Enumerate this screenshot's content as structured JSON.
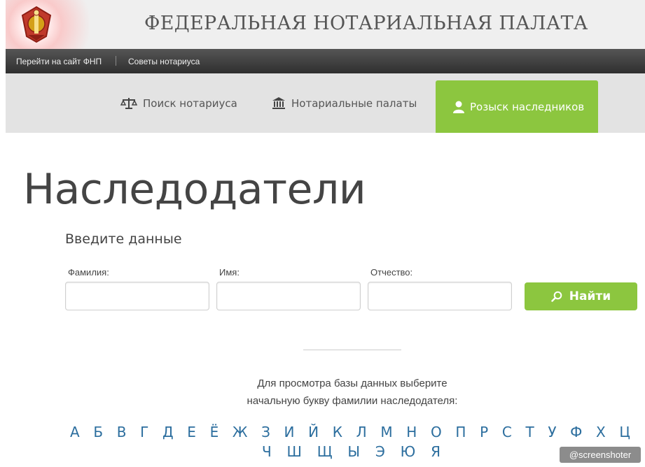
{
  "header": {
    "logo_icon": "fnp-emblem-icon",
    "title": "ФЕДЕРАЛЬНАЯ НОТАРИАЛЬНАЯ ПАЛАТА"
  },
  "topbar": {
    "links": [
      "Перейти на сайт ФНП",
      "Советы нотариуса"
    ]
  },
  "tabs": [
    {
      "label": "Поиск нотариуса",
      "icon": "scales-icon",
      "active": false
    },
    {
      "label": "Нотариальные палаты",
      "icon": "building-icon",
      "active": false
    },
    {
      "label": "Розыск наследников",
      "icon": "person-icon",
      "active": true
    }
  ],
  "page": {
    "title": "Наследодатели",
    "subtitle": "Введите данные"
  },
  "form": {
    "fields": [
      {
        "label": "Фамилия:",
        "value": ""
      },
      {
        "label": "Имя:",
        "value": ""
      },
      {
        "label": "Отчество:",
        "value": ""
      }
    ],
    "search_button": "Найти"
  },
  "hint": {
    "line1": "Для просмотра базы данных выберите",
    "line2": "начальную букву фамилии наследодателя:"
  },
  "alphabet": {
    "row1": [
      "А",
      "Б",
      "В",
      "Г",
      "Д",
      "Е",
      "Ё",
      "Ж",
      "З",
      "И",
      "Й",
      "К",
      "Л",
      "М",
      "Н",
      "О",
      "П",
      "Р",
      "С",
      "Т",
      "У",
      "Ф",
      "Х",
      "Ц"
    ],
    "row2": [
      "Ч",
      "Ш",
      "Щ",
      "Ы",
      "Э",
      "Ю",
      "Я"
    ]
  },
  "watermark": "@screenshoter",
  "colors": {
    "accent_green": "#8cc63f",
    "letter_link": "#2c6e9e",
    "topbar": "#3a3a3a",
    "tabsbar": "#e3e3e3"
  }
}
